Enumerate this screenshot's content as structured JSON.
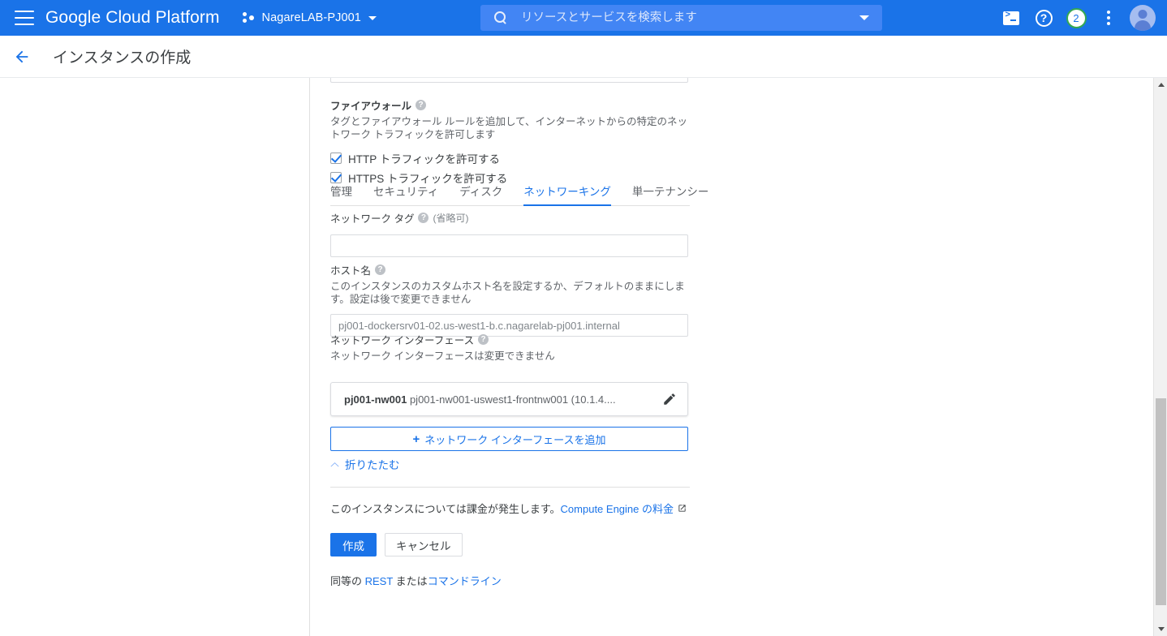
{
  "header": {
    "menu_label": "menu",
    "brand": "Google Cloud Platform",
    "project": "NagareLAB-PJ001",
    "search_placeholder": "リソースとサービスを検索します",
    "search_value": "",
    "notification_count": "2",
    "help_glyph": "?"
  },
  "titlebar": {
    "page_title": "インスタンスの作成"
  },
  "firewall": {
    "label": "ファイアウォール",
    "help_glyph": "?",
    "description": "タグとファイアウォール ルールを追加して、インターネットからの特定のネットワーク トラフィックを許可します",
    "options": [
      {
        "label": "HTTP トラフィックを許可する",
        "checked": true
      },
      {
        "label": "HTTPS トラフィックを許可する",
        "checked": true
      }
    ]
  },
  "tabs": [
    {
      "label": "管理",
      "active": false
    },
    {
      "label": "セキュリティ",
      "active": false
    },
    {
      "label": "ディスク",
      "active": false
    },
    {
      "label": "ネットワーキング",
      "active": true
    },
    {
      "label": "単一テナンシー",
      "active": false
    }
  ],
  "network_tag": {
    "label": "ネットワーク タグ",
    "help_glyph": "?",
    "optional": "(省略可)",
    "value": "",
    "placeholder": ""
  },
  "hostname": {
    "label": "ホスト名",
    "help_glyph": "?",
    "description": "このインスタンスのカスタムホスト名を設定するか、デフォルトのままにします。設定は後で変更できません",
    "value": "",
    "placeholder": "pj001-dockersrv01-02.us-west1-b.c.nagarelab-pj001.internal"
  },
  "network_interface": {
    "label": "ネットワーク インターフェース",
    "help_glyph": "?",
    "description": "ネットワーク インターフェースは変更できません",
    "card": {
      "name": "pj001-nw001",
      "detail": "pj001-nw001-uswest1-frontnw001 (10.1.4...."
    },
    "add_button": "ネットワーク インターフェースを追加",
    "add_plus": "+"
  },
  "collapse": {
    "label": "折りたたむ"
  },
  "footer": {
    "billing_text": "このインスタンスについては課金が発生します。",
    "billing_link": "Compute Engine の料金",
    "create_button": "作成",
    "cancel_button": "キャンセル",
    "rest_prefix": "同等の ",
    "rest_link": "REST",
    "rest_middle": " または",
    "cli_link": "コマンドライン"
  },
  "colors": {
    "brand_blue": "#1a73e8",
    "header_blue": "#1a73e8",
    "search_blue": "#4285f4",
    "badge_green": "#34a853",
    "text_primary": "#3c4043",
    "text_secondary": "#5f6368",
    "border": "#dadce0"
  }
}
